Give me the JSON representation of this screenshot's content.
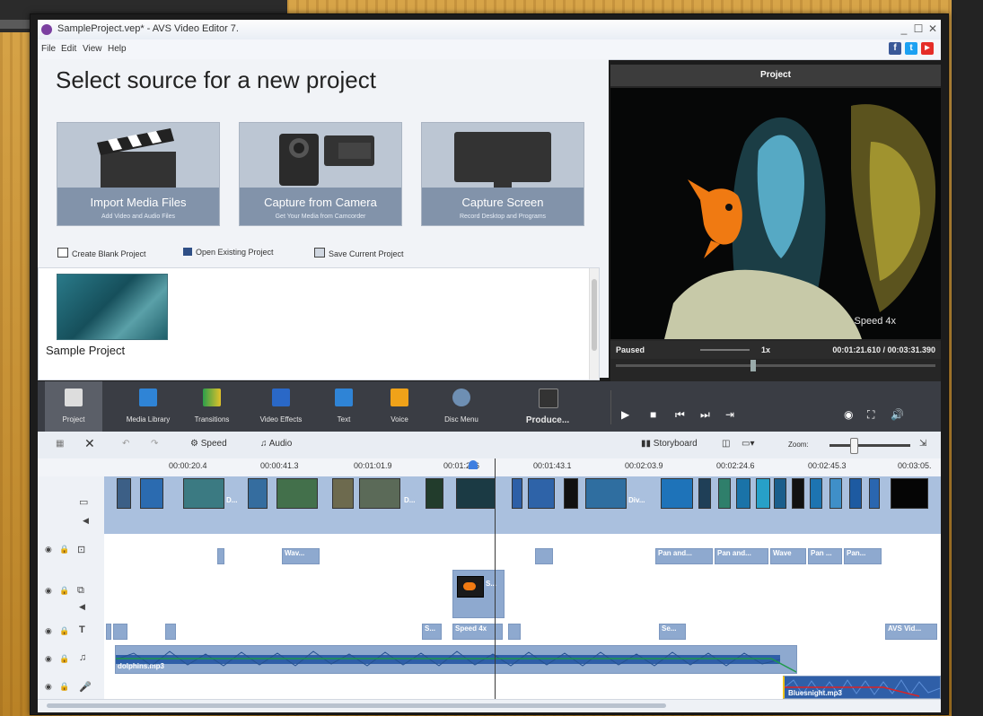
{
  "window": {
    "title": "SampleProject.vep* - AVS Video Editor 7.",
    "controls": [
      "_",
      "☐",
      "✕"
    ]
  },
  "menu": [
    "File",
    "Edit",
    "View",
    "Help"
  ],
  "social": [
    "f",
    "t",
    "▶"
  ],
  "source": {
    "heading": "Select source for a new project",
    "tiles": [
      {
        "label": "Import Media Files",
        "sub": "Add Video and Audio Files"
      },
      {
        "label": "Capture from Camera",
        "sub": "Get Your Media from Camcorder"
      },
      {
        "label": "Capture Screen",
        "sub": "Record Desktop and Programs"
      }
    ],
    "actions": [
      "Create Blank Project",
      "Open Existing Project",
      "Save Current Project"
    ],
    "sample_label": "Sample Project"
  },
  "preview": {
    "header": "Project",
    "overlay": "Speed 4x",
    "status": "Paused",
    "speed": "1x",
    "time": "00:01:21.610 / 00:03:31.390"
  },
  "toolbar": [
    "Project",
    "Media Library",
    "Transitions",
    "Video Effects",
    "Text",
    "Voice",
    "Disc Menu",
    "Produce..."
  ],
  "timeline_tools": {
    "speed": "Speed",
    "audio": "Audio",
    "storyboard": "Storyboard",
    "zoom": "Zoom:"
  },
  "ruler": [
    "00:00:20.4",
    "00:00:41.3",
    "00:01:01.9",
    "00:01:226",
    "00:01:43.1",
    "00:02:03.9",
    "00:02:24.6",
    "00:02:45.3",
    "00:03:05."
  ],
  "clips": {
    "effects": [
      "Wav...",
      "Pan and...",
      "Pan and...",
      "Wave",
      "Pan ...",
      "Pan..."
    ],
    "overlay": "S...",
    "text": [
      "S...",
      "Speed 4x",
      "Se...",
      "AVS Vid..."
    ],
    "audio1": "dolphins.mp3",
    "audio2": "Bluesnight.mp3",
    "video_labels": [
      "D...",
      "D...",
      "Div..."
    ]
  },
  "colors": {
    "accent": "#3e7ee0",
    "clip": "#8ea9cf",
    "toolbar": "#3a3d44",
    "audio_wave": "#2f5fa8"
  }
}
